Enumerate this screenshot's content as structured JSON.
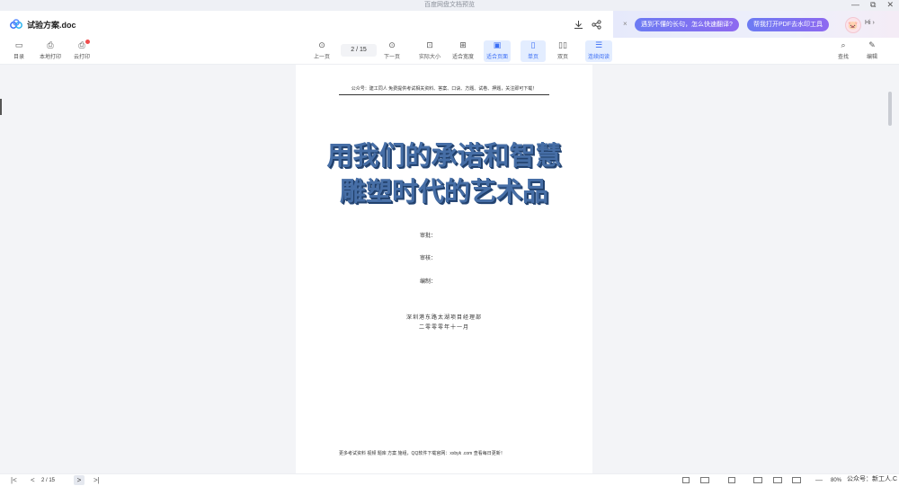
{
  "window": {
    "title": "百度网盘文档预览",
    "controls": [
      "—",
      "⧉",
      "✕"
    ]
  },
  "header": {
    "doc_name": "试验方案.doc",
    "icons": [
      "download-icon",
      "share-icon"
    ]
  },
  "promo": {
    "close": "×",
    "pill1": "遇到不懂的长句，怎么快速翻译?",
    "pill2": "帮我打开PDF去水印工具",
    "avatar": "🐷",
    "hi": "Hi ›"
  },
  "toolbar": {
    "toc": "目录",
    "local_print": "本地打印",
    "cloud_print": "云打印",
    "prev_page": "上一页",
    "page_indicator": "2 / 15",
    "next_page": "下一页",
    "actual_size": "实际大小",
    "fit_width": "适合宽度",
    "fit_page": "适合页面",
    "single_page": "单页",
    "double_page": "双页",
    "continuous": "连续阅读",
    "search": "查找",
    "edit": "编辑"
  },
  "document": {
    "header_line": "公众号：建工同人 免费提供考试相关资料、答案、口诀、方题、试卷、押题，关注即可下载！",
    "title_line1": "用我们的承诺和智慧",
    "title_line2": "雕塑时代的艺术品",
    "approve": "审批：",
    "review": "审核：",
    "compile": "编制：",
    "org": "深圳港东路太湖项目经理部",
    "date": "二零零零年十一月",
    "footer": "更多考试资料 视频 题库 方案 施组，QQ软件下载官网：xxbyk .com 查看每日更新！"
  },
  "statusbar": {
    "first": "|<",
    "prev": "<",
    "page": "2 / 15",
    "next": ">",
    "last": ">|",
    "zoom_minus": "—",
    "zoom": "80%",
    "zoom_plus": "+"
  },
  "watermark": "公众号：新工人.C"
}
